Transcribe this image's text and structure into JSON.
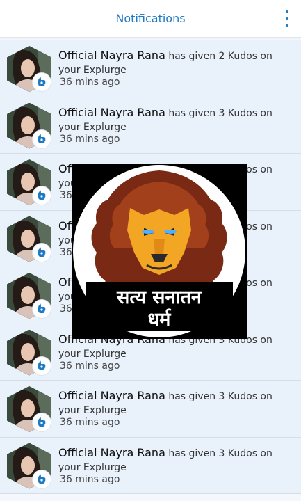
{
  "header": {
    "title": "Notifications",
    "menu_icon": "more-vert-icon"
  },
  "notifications": [
    {
      "name": "Official Nayra Rana",
      "message": "has given 2 Kudos on your Explurge",
      "time": "36 mins ago"
    },
    {
      "name": "Official Nayra Rana",
      "message": "has given 3 Kudos on your Explurge",
      "time": "36 mins ago"
    },
    {
      "name": "Official Nayra Rana",
      "message": "has given 3 Kudos on your Explurge",
      "time": "36 mins ago"
    },
    {
      "name": "Official Nayra Rana",
      "message": "has given 3 Kudos on your Explurge",
      "time": "36 mins ago"
    },
    {
      "name": "Official Nayra Rana",
      "message": "has given 3 Kudos on your Explurge",
      "time": "36 mins ago"
    },
    {
      "name": "Official Nayra Rana",
      "message": "has given 3 Kudos on your Explurge",
      "time": "36 mins ago"
    },
    {
      "name": "Official Nayra Rana",
      "message": "has given 3 Kudos on your Explurge",
      "time": "36 mins ago"
    },
    {
      "name": "Official Nayra Rana",
      "message": "has given 3 Kudos on your Explurge",
      "time": "36 mins ago"
    }
  ],
  "overlay_logo": {
    "line1": "सत्य सनातन",
    "line2": "धर्म"
  },
  "colors": {
    "accent": "#1f7ac4",
    "row_bg": "#e9f1fb",
    "header_bg": "#ffffff"
  }
}
